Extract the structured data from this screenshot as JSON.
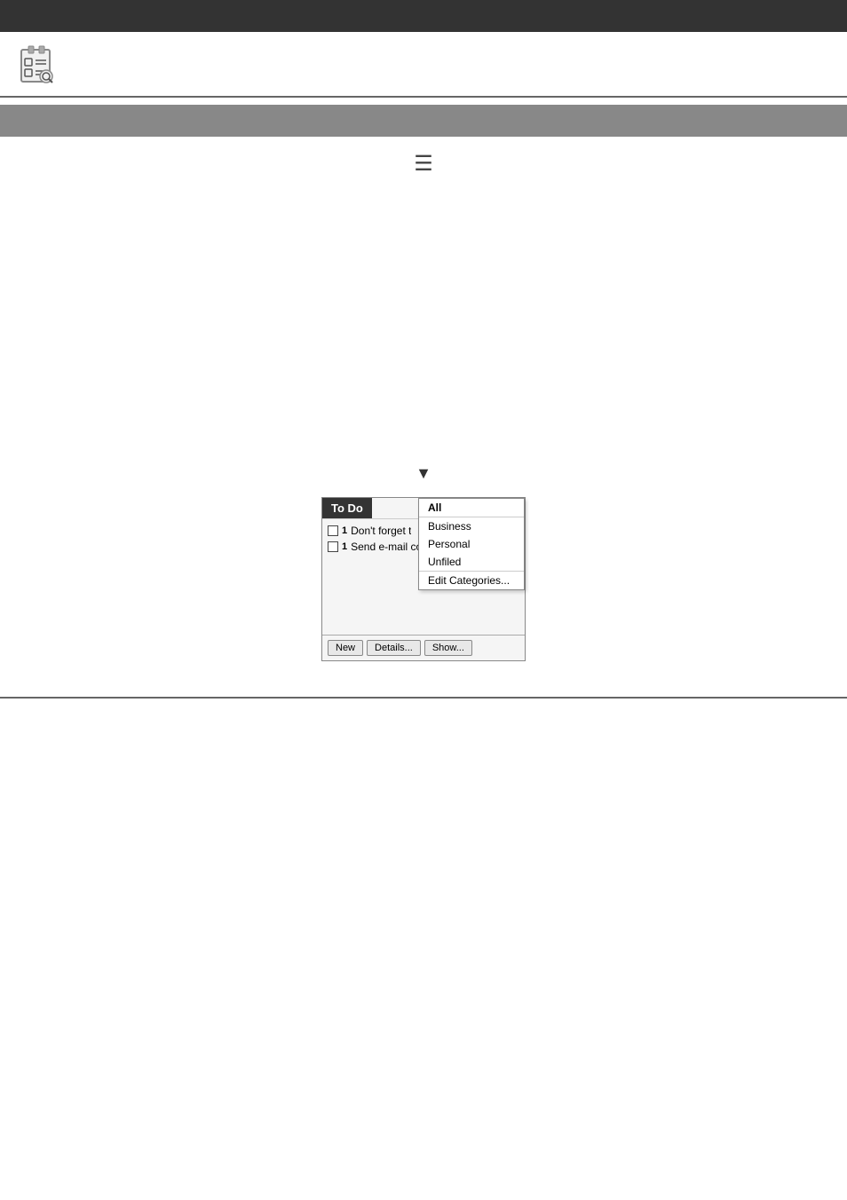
{
  "topBar": {
    "bg": "#333333"
  },
  "header": {
    "iconAlt": "To Do application icon"
  },
  "sectionHeader": {
    "bg": "#888888"
  },
  "listIcon": {
    "symbol": "☰",
    "label": "list icon"
  },
  "dropdownIndicator": {
    "symbol": "▼",
    "label": "dropdown arrow"
  },
  "todoWidget": {
    "title": "To Do",
    "items": [
      {
        "checked": false,
        "priority": "1",
        "text": "Don't forget t"
      },
      {
        "checked": false,
        "priority": "1",
        "text": "Send e-mail co"
      }
    ],
    "dropdown": {
      "options": [
        {
          "label": "All",
          "bold": true
        },
        {
          "label": "Business"
        },
        {
          "label": "Personal"
        },
        {
          "label": "Unfiled"
        },
        {
          "label": "Edit Categories...",
          "special": true
        }
      ]
    },
    "buttons": [
      {
        "label": "New"
      },
      {
        "label": "Details..."
      },
      {
        "label": "Show..."
      }
    ]
  }
}
